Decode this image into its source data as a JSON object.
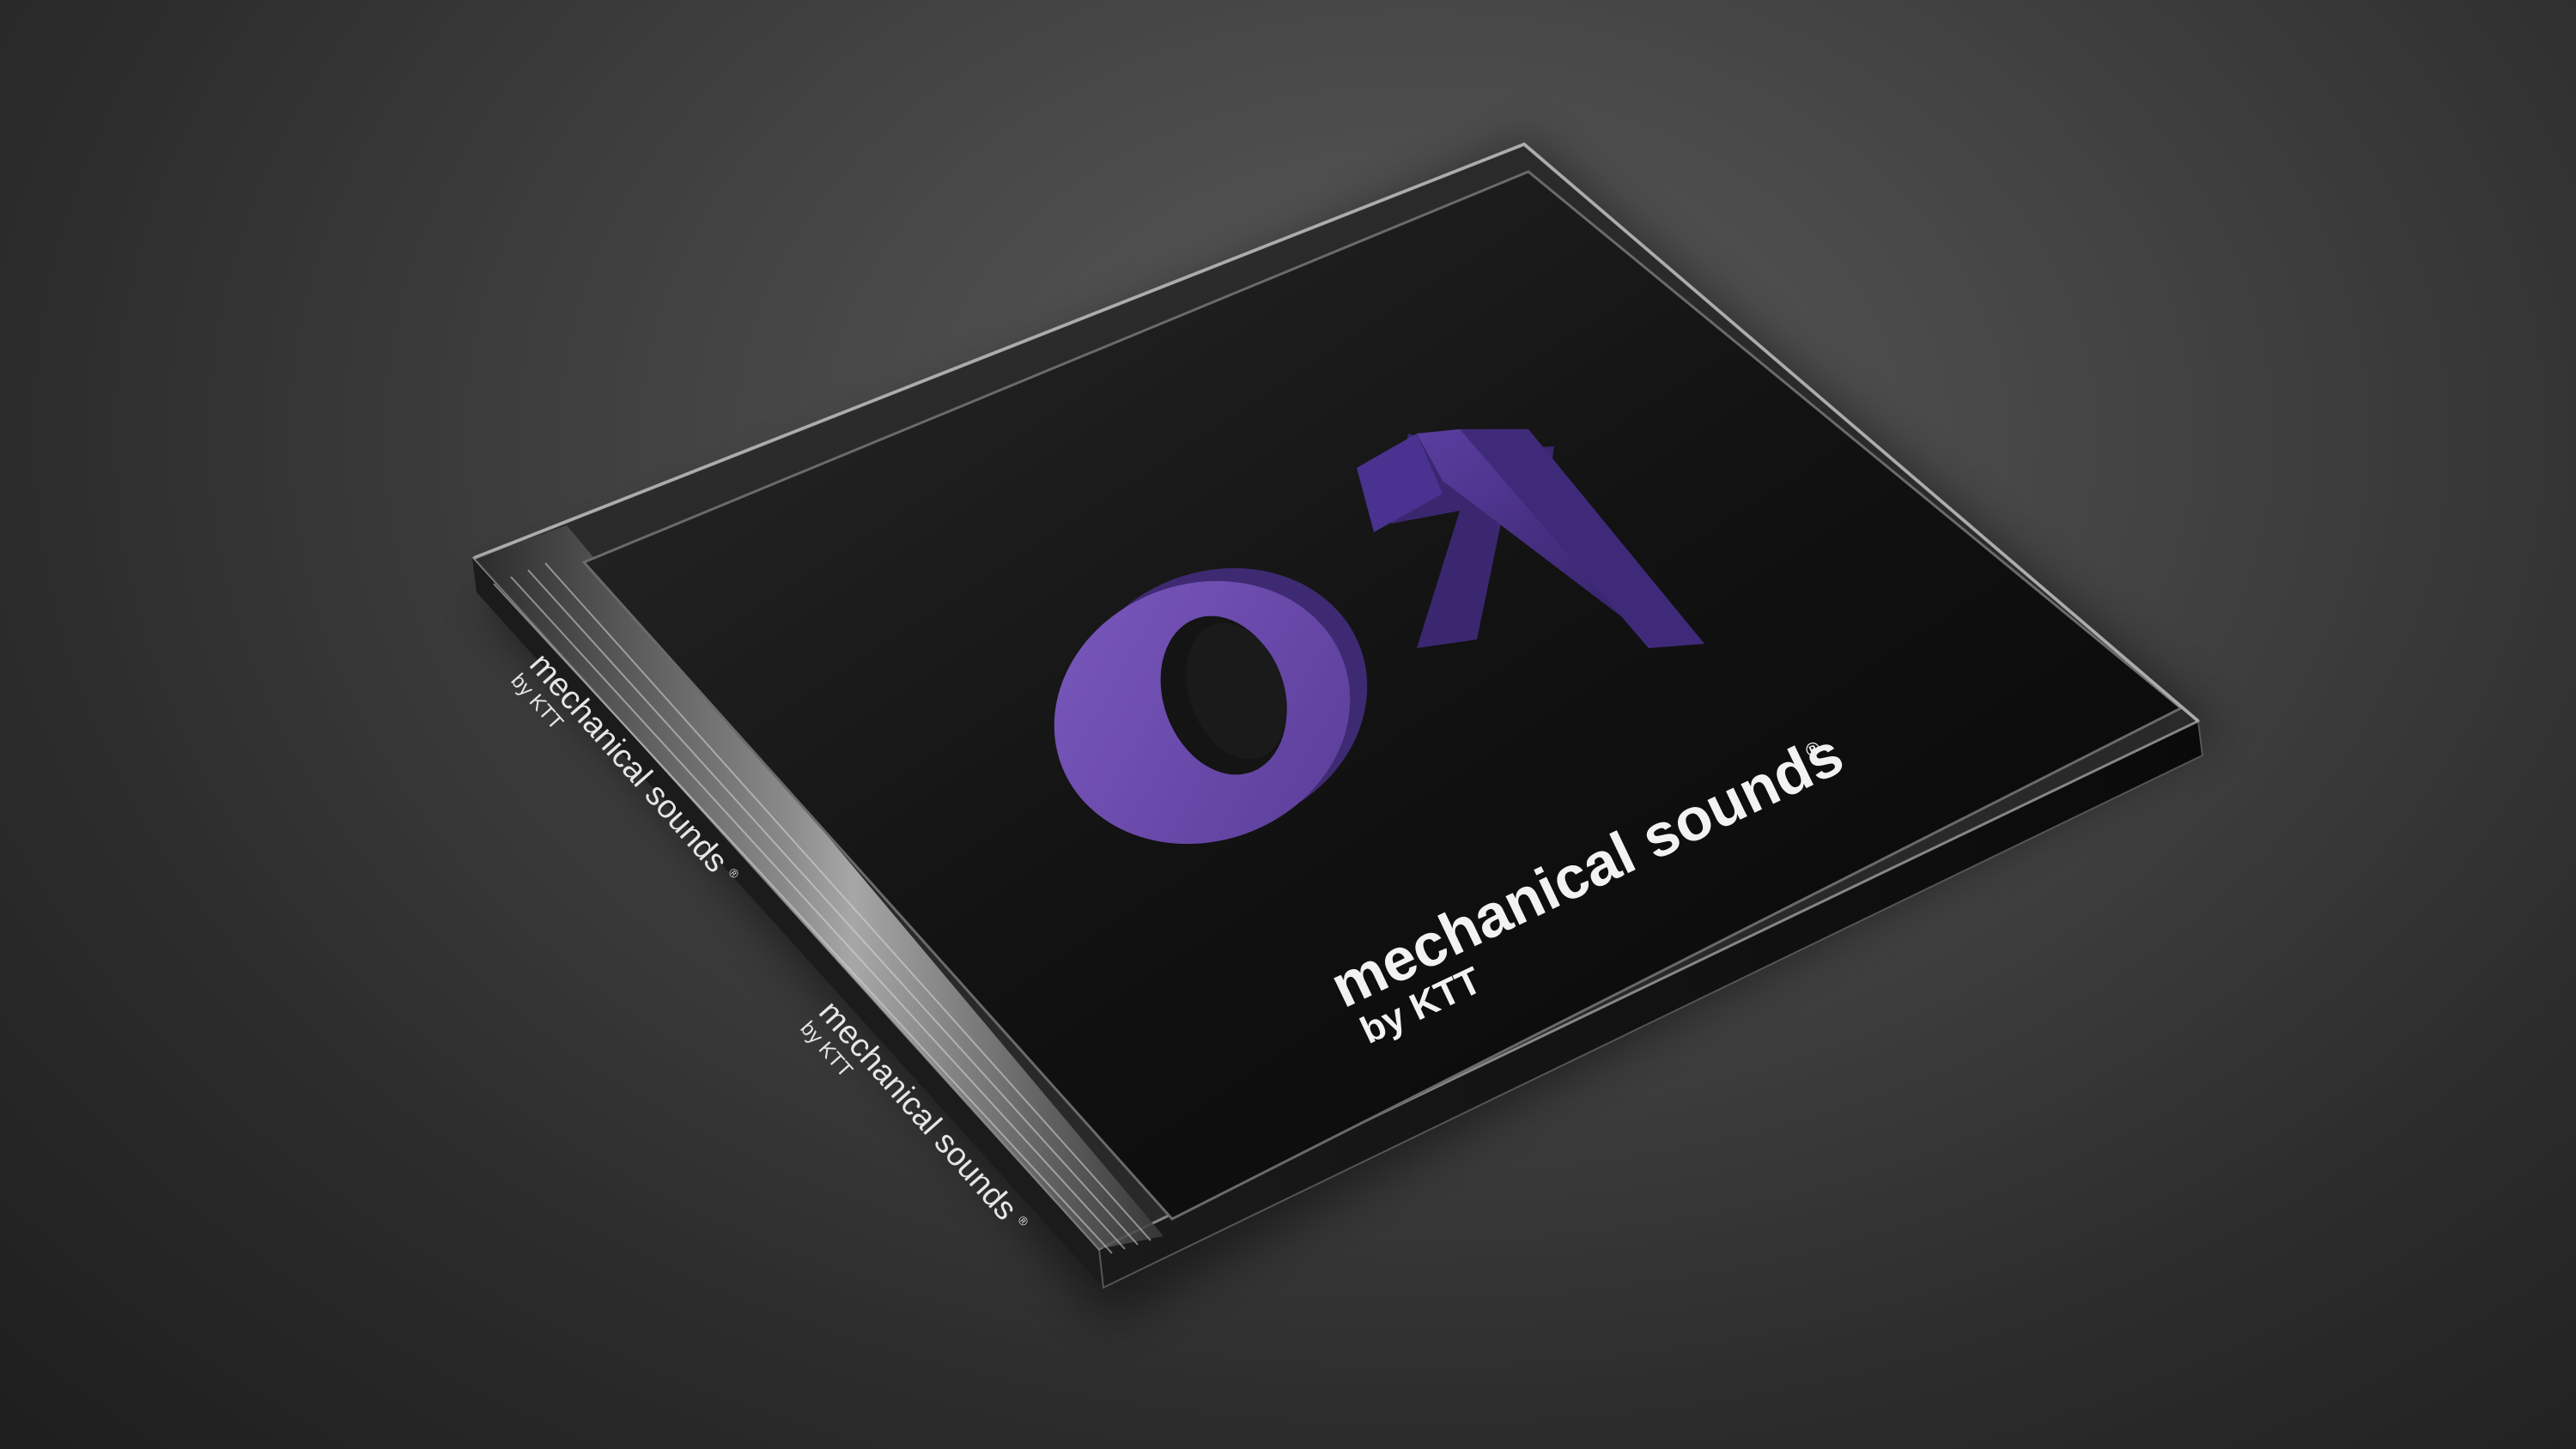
{
  "product": {
    "number": "01",
    "title": "mechanical sounds",
    "registered_mark": "®",
    "byline": "by KTT"
  },
  "spine": {
    "title": "mechanical sounds",
    "registered_mark": "®",
    "byline": "by KTT"
  },
  "colors": {
    "background": "#3a3a3a",
    "cover": "#141414",
    "numeral_front": "#6a4aa8",
    "numeral_side": "#3e2a72",
    "text": "#f2f2f2"
  }
}
